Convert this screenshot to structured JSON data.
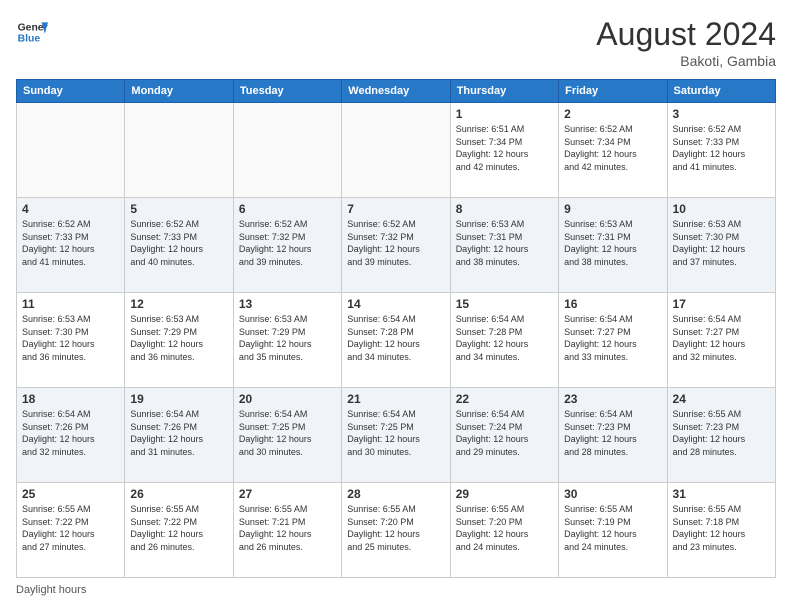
{
  "header": {
    "logo_line1": "General",
    "logo_line2": "Blue",
    "month_year": "August 2024",
    "location": "Bakoti, Gambia"
  },
  "weekdays": [
    "Sunday",
    "Monday",
    "Tuesday",
    "Wednesday",
    "Thursday",
    "Friday",
    "Saturday"
  ],
  "weeks": [
    [
      {
        "day": "",
        "info": ""
      },
      {
        "day": "",
        "info": ""
      },
      {
        "day": "",
        "info": ""
      },
      {
        "day": "",
        "info": ""
      },
      {
        "day": "1",
        "info": "Sunrise: 6:51 AM\nSunset: 7:34 PM\nDaylight: 12 hours\nand 42 minutes."
      },
      {
        "day": "2",
        "info": "Sunrise: 6:52 AM\nSunset: 7:34 PM\nDaylight: 12 hours\nand 42 minutes."
      },
      {
        "day": "3",
        "info": "Sunrise: 6:52 AM\nSunset: 7:33 PM\nDaylight: 12 hours\nand 41 minutes."
      }
    ],
    [
      {
        "day": "4",
        "info": "Sunrise: 6:52 AM\nSunset: 7:33 PM\nDaylight: 12 hours\nand 41 minutes."
      },
      {
        "day": "5",
        "info": "Sunrise: 6:52 AM\nSunset: 7:33 PM\nDaylight: 12 hours\nand 40 minutes."
      },
      {
        "day": "6",
        "info": "Sunrise: 6:52 AM\nSunset: 7:32 PM\nDaylight: 12 hours\nand 39 minutes."
      },
      {
        "day": "7",
        "info": "Sunrise: 6:52 AM\nSunset: 7:32 PM\nDaylight: 12 hours\nand 39 minutes."
      },
      {
        "day": "8",
        "info": "Sunrise: 6:53 AM\nSunset: 7:31 PM\nDaylight: 12 hours\nand 38 minutes."
      },
      {
        "day": "9",
        "info": "Sunrise: 6:53 AM\nSunset: 7:31 PM\nDaylight: 12 hours\nand 38 minutes."
      },
      {
        "day": "10",
        "info": "Sunrise: 6:53 AM\nSunset: 7:30 PM\nDaylight: 12 hours\nand 37 minutes."
      }
    ],
    [
      {
        "day": "11",
        "info": "Sunrise: 6:53 AM\nSunset: 7:30 PM\nDaylight: 12 hours\nand 36 minutes."
      },
      {
        "day": "12",
        "info": "Sunrise: 6:53 AM\nSunset: 7:29 PM\nDaylight: 12 hours\nand 36 minutes."
      },
      {
        "day": "13",
        "info": "Sunrise: 6:53 AM\nSunset: 7:29 PM\nDaylight: 12 hours\nand 35 minutes."
      },
      {
        "day": "14",
        "info": "Sunrise: 6:54 AM\nSunset: 7:28 PM\nDaylight: 12 hours\nand 34 minutes."
      },
      {
        "day": "15",
        "info": "Sunrise: 6:54 AM\nSunset: 7:28 PM\nDaylight: 12 hours\nand 34 minutes."
      },
      {
        "day": "16",
        "info": "Sunrise: 6:54 AM\nSunset: 7:27 PM\nDaylight: 12 hours\nand 33 minutes."
      },
      {
        "day": "17",
        "info": "Sunrise: 6:54 AM\nSunset: 7:27 PM\nDaylight: 12 hours\nand 32 minutes."
      }
    ],
    [
      {
        "day": "18",
        "info": "Sunrise: 6:54 AM\nSunset: 7:26 PM\nDaylight: 12 hours\nand 32 minutes."
      },
      {
        "day": "19",
        "info": "Sunrise: 6:54 AM\nSunset: 7:26 PM\nDaylight: 12 hours\nand 31 minutes."
      },
      {
        "day": "20",
        "info": "Sunrise: 6:54 AM\nSunset: 7:25 PM\nDaylight: 12 hours\nand 30 minutes."
      },
      {
        "day": "21",
        "info": "Sunrise: 6:54 AM\nSunset: 7:25 PM\nDaylight: 12 hours\nand 30 minutes."
      },
      {
        "day": "22",
        "info": "Sunrise: 6:54 AM\nSunset: 7:24 PM\nDaylight: 12 hours\nand 29 minutes."
      },
      {
        "day": "23",
        "info": "Sunrise: 6:54 AM\nSunset: 7:23 PM\nDaylight: 12 hours\nand 28 minutes."
      },
      {
        "day": "24",
        "info": "Sunrise: 6:55 AM\nSunset: 7:23 PM\nDaylight: 12 hours\nand 28 minutes."
      }
    ],
    [
      {
        "day": "25",
        "info": "Sunrise: 6:55 AM\nSunset: 7:22 PM\nDaylight: 12 hours\nand 27 minutes."
      },
      {
        "day": "26",
        "info": "Sunrise: 6:55 AM\nSunset: 7:22 PM\nDaylight: 12 hours\nand 26 minutes."
      },
      {
        "day": "27",
        "info": "Sunrise: 6:55 AM\nSunset: 7:21 PM\nDaylight: 12 hours\nand 26 minutes."
      },
      {
        "day": "28",
        "info": "Sunrise: 6:55 AM\nSunset: 7:20 PM\nDaylight: 12 hours\nand 25 minutes."
      },
      {
        "day": "29",
        "info": "Sunrise: 6:55 AM\nSunset: 7:20 PM\nDaylight: 12 hours\nand 24 minutes."
      },
      {
        "day": "30",
        "info": "Sunrise: 6:55 AM\nSunset: 7:19 PM\nDaylight: 12 hours\nand 24 minutes."
      },
      {
        "day": "31",
        "info": "Sunrise: 6:55 AM\nSunset: 7:18 PM\nDaylight: 12 hours\nand 23 minutes."
      }
    ]
  ],
  "footer": {
    "daylight_label": "Daylight hours"
  }
}
